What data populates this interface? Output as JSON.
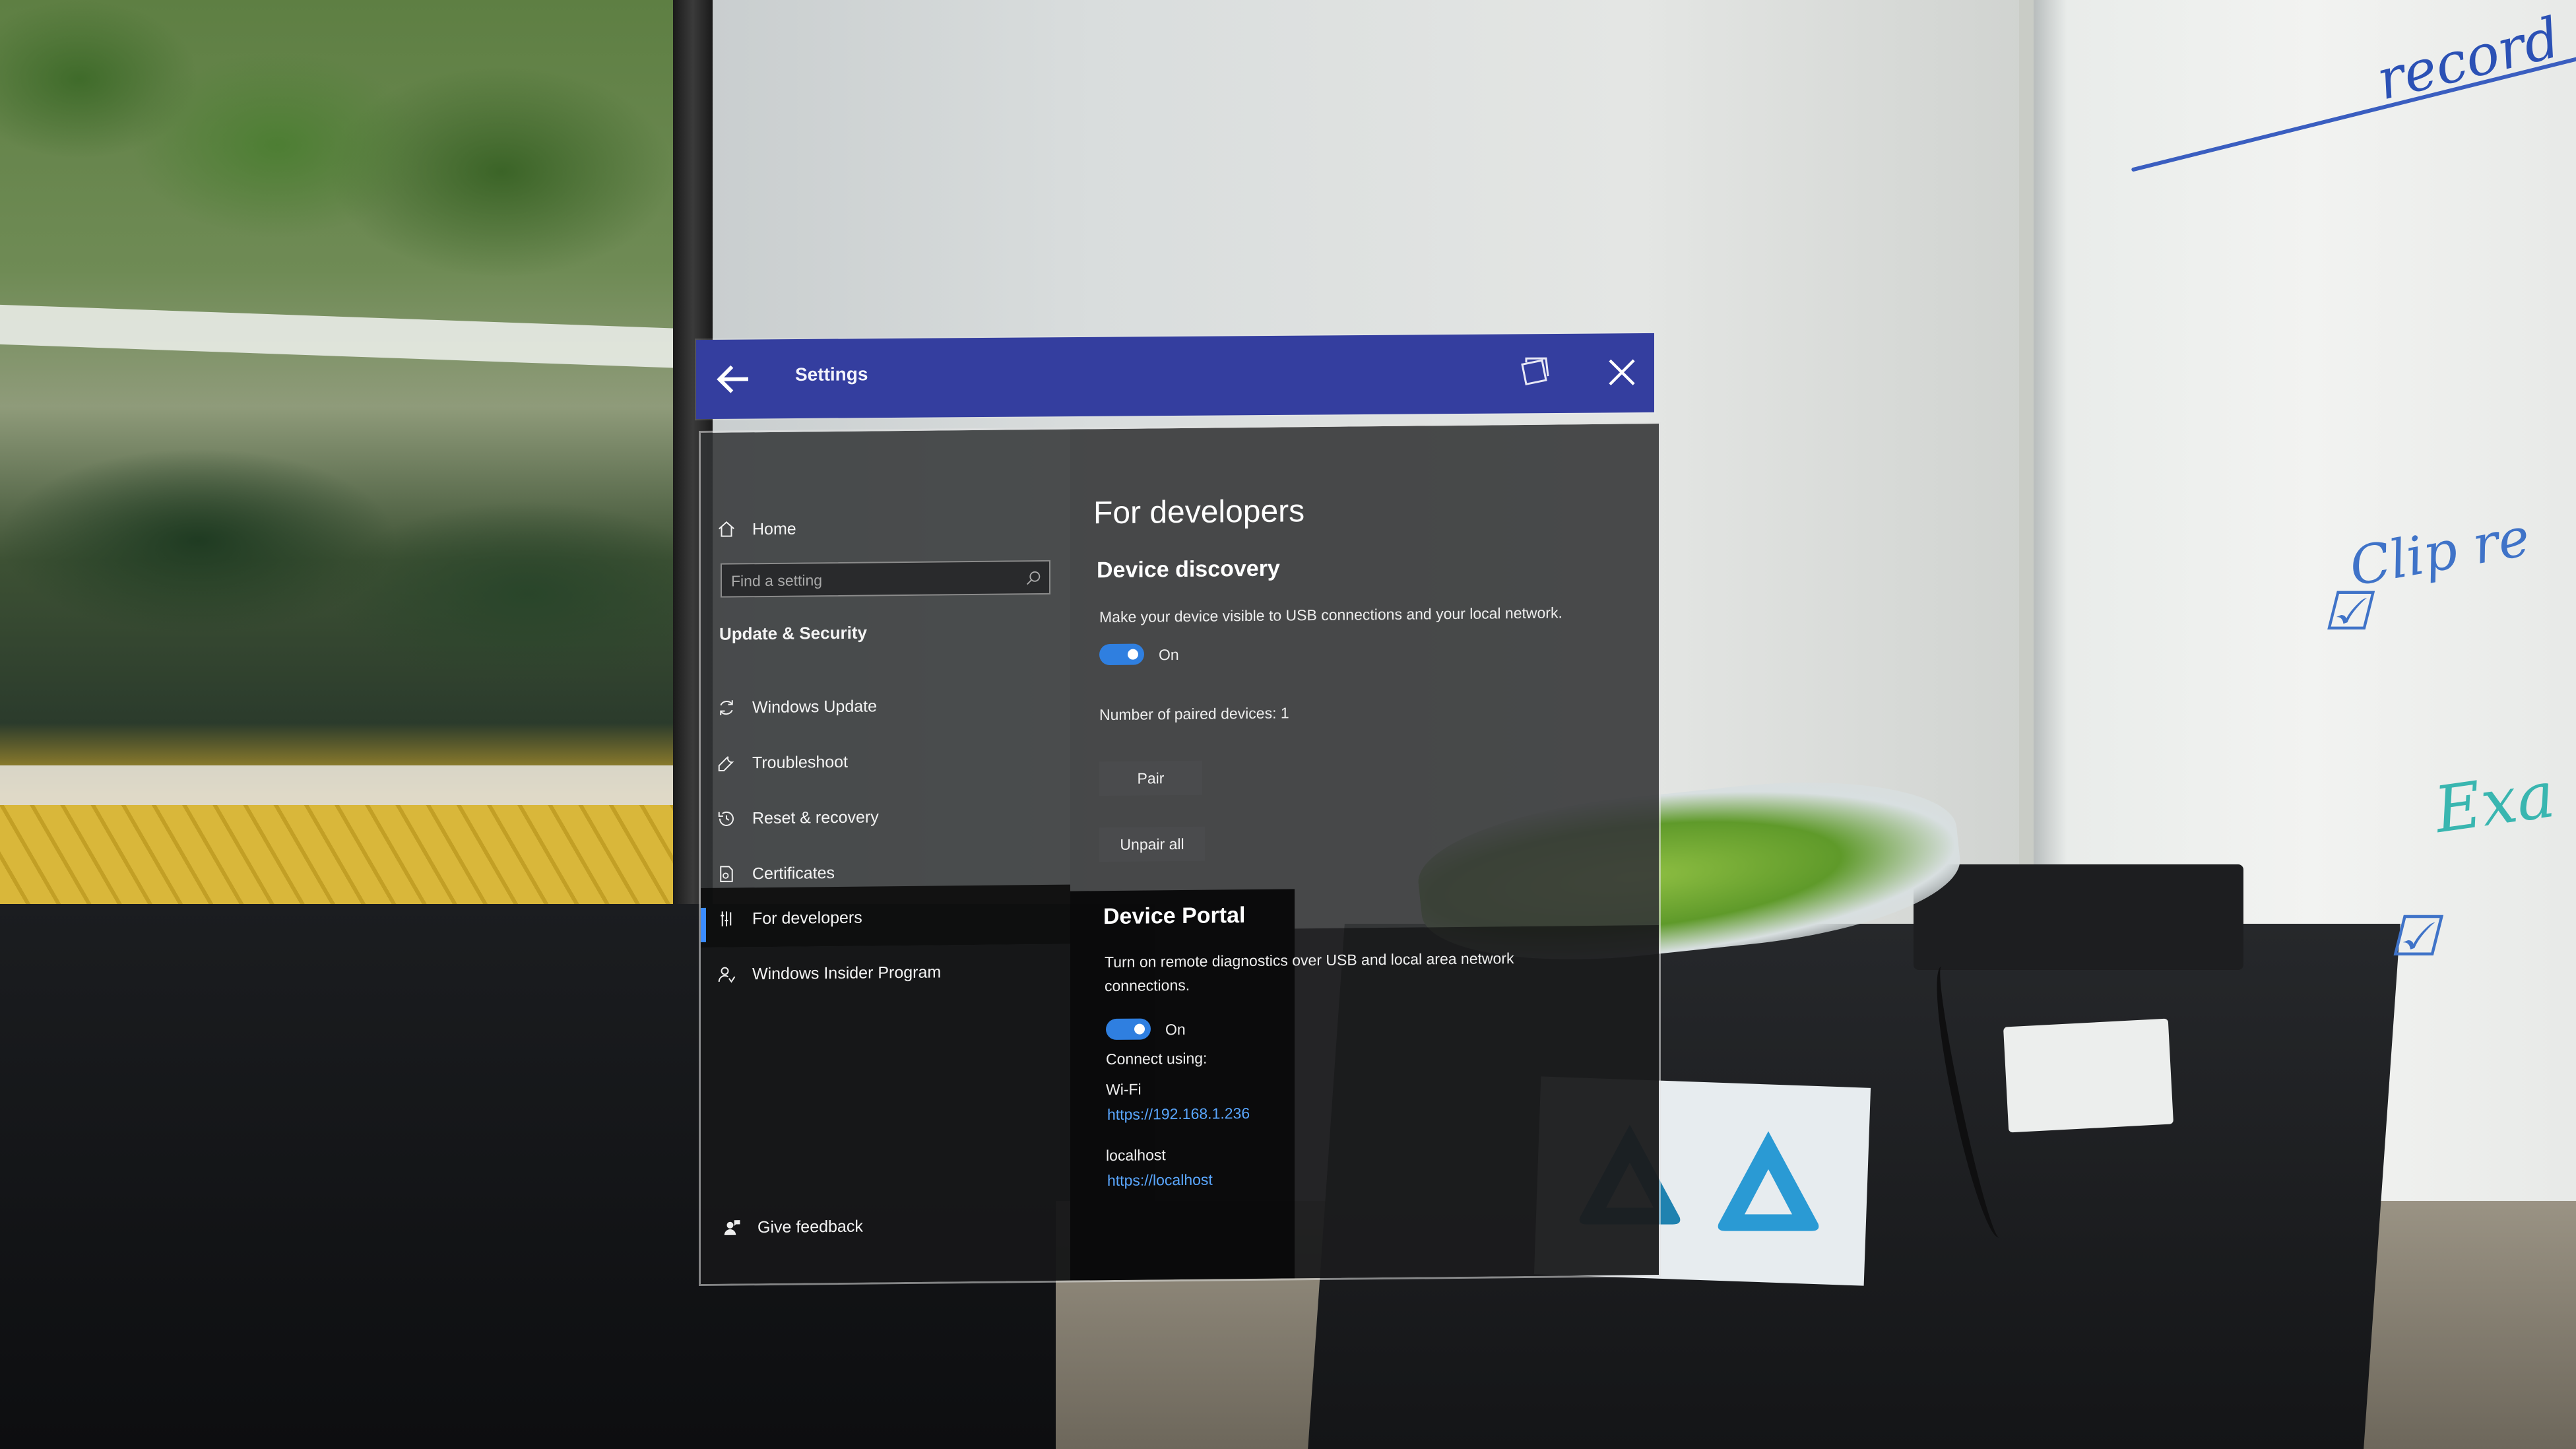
{
  "window": {
    "title": "Settings"
  },
  "sidebar": {
    "home_label": "Home",
    "search_placeholder": "Find a setting",
    "section_heading": "Update & Security",
    "items": [
      {
        "label": "Windows Update",
        "icon": "sync-icon"
      },
      {
        "label": "Troubleshoot",
        "icon": "wrench-icon"
      },
      {
        "label": "Reset & recovery",
        "icon": "history-icon"
      },
      {
        "label": "Certificates",
        "icon": "certificate-icon"
      },
      {
        "label": "For developers",
        "icon": "developer-tools-icon",
        "selected": true
      },
      {
        "label": "Windows Insider Program",
        "icon": "insider-person-icon"
      }
    ],
    "feedback_label": "Give feedback"
  },
  "main": {
    "page_title": "For developers",
    "device_discovery": {
      "heading": "Device discovery",
      "description": "Make your device visible to USB connections and your local network.",
      "toggle_state": "On",
      "paired_devices_text": "Number of paired devices: 1",
      "pair_button": "Pair",
      "unpair_button": "Unpair all"
    },
    "device_portal": {
      "heading": "Device Portal",
      "description": "Turn on remote diagnostics over USB and local area network connections.",
      "toggle_state": "On",
      "connect_label": "Connect using:",
      "wifi_label": "Wi-Fi",
      "wifi_url": "https://192.168.1.236",
      "localhost_label": "localhost",
      "localhost_url": "https://localhost"
    }
  },
  "background": {
    "whiteboard_text": [
      "record",
      "Clip re",
      "Exa"
    ]
  },
  "colors": {
    "title_bar": "#343e9f",
    "accent": "#2f7fe0",
    "link": "#5aa7ff",
    "panel": "#363738"
  }
}
